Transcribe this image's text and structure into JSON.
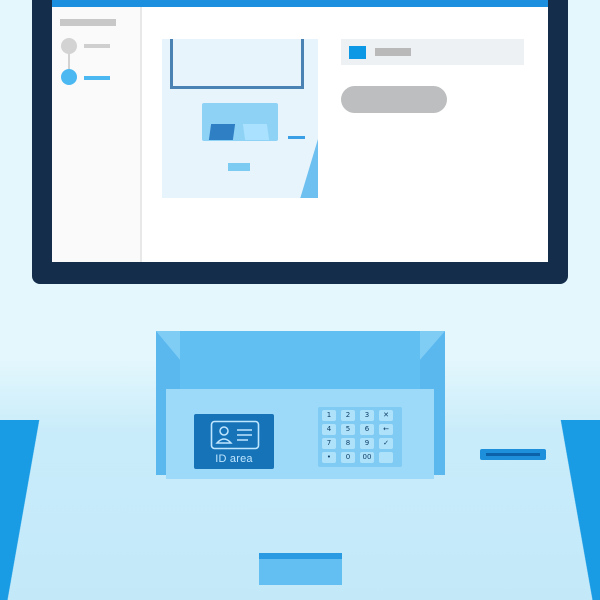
{
  "id_area": {
    "label": "ID area"
  },
  "keypad": {
    "keys": [
      "1",
      "2",
      "3",
      "✕",
      "4",
      "5",
      "6",
      "←",
      "7",
      "8",
      "9",
      "✓",
      "•",
      "0",
      "00",
      ""
    ]
  },
  "colors": {
    "accent": "#1c8fde",
    "frame": "#132d4a",
    "console": "#7fcdf5",
    "id_area": "#1673b8"
  },
  "icons": {
    "id_card": "id-card-icon",
    "cancel": "cancel-icon",
    "backspace": "backspace-icon",
    "confirm": "checkmark-icon"
  }
}
